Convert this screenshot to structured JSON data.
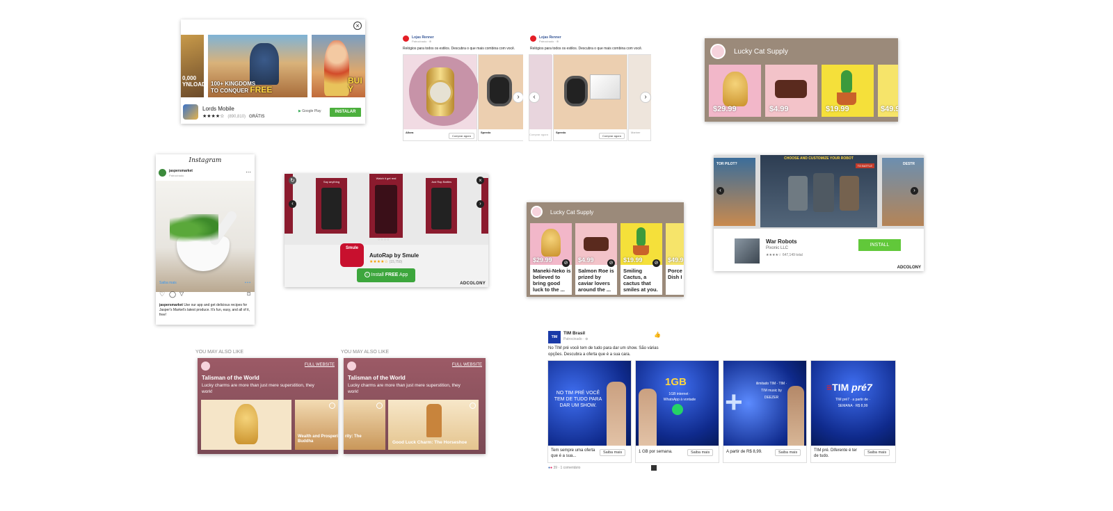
{
  "lords": {
    "close": "×",
    "app_name": "Lords Mobile",
    "stars": "★★★★☆",
    "reviews": "(890,810)",
    "price": "GRÁTIS",
    "store": "Google Play",
    "install": "INSTALAR",
    "banner1": "100+ KINGDOMS",
    "banner2": "TO CONQUER",
    "banner_free": "FREE",
    "left_text": "0,000",
    "left_text2": "YNLOADS",
    "right_text": "BUI",
    "right_text2": "Y"
  },
  "renner": {
    "brand": "Lojas Renner",
    "sponsored": "Patrocinado · ⊕",
    "copy": "Relógios para todos os estilos. Descubra o que mais combina com você.",
    "cta": "Comprar agora",
    "a": {
      "item1": "Allora",
      "item2": "Speedo"
    },
    "b": {
      "item1": "Speedo",
      "item2": "Mariner"
    }
  },
  "lucky_top": {
    "title": "Lucky Cat Supply",
    "prices": [
      "$29.99",
      "$4.99",
      "$19.99",
      "$49.9"
    ]
  },
  "instagram": {
    "logo": "Instagram",
    "handle": "jaspersmarket",
    "sponsored": "Patrocinado",
    "learn": "Saiba mais",
    "caption_user": "jaspersmarket",
    "caption": "Use our app and get delicious recipes for Jasper's Market's latest produce. It's fun, easy, and all of it, free!"
  },
  "autorap": {
    "app_name": "AutoRap by Smule",
    "stars": "★★★★☆",
    "reviews": "(15,750)",
    "install_pre": "Install ",
    "install_bold": "FREE",
    "install_post": " App",
    "brand": "ADCOLONY",
    "logo": "Smule",
    "screens": [
      "Say anything",
      "Watch it get real",
      "Just Rap Battles"
    ]
  },
  "lucky_mid": {
    "title": "Lucky Cat Supply",
    "prices": [
      "$29.99",
      "$4.99",
      "$19.99",
      "$49.9"
    ],
    "descs": [
      "Maneki-Neko is believed to bring good luck to the ...",
      "Salmon Roe is prized by caviar lovers around the ...",
      "Smiling Cactus, a cactus that smiles at you.",
      "Porce Dish I"
    ]
  },
  "warrobots": {
    "app_name": "War Robots",
    "developer": "Pixonic LLC",
    "stars": "★★★★☆",
    "reviews": "647,149 total",
    "install": "INSTALL",
    "brand": "ADCOLONY",
    "screen_title": "CHOOSE AND CUSTOMIZE YOUR ROBOT",
    "battle": "TO BATTLE",
    "left_label": "TOR PILOT?",
    "right_label": "DESTR"
  },
  "talisman": {
    "section": "YOU MAY ALSO LIKE",
    "full_site": "FULL WEBSITE",
    "title": "Talisman of the World",
    "body": "Lucky charms are more than just mere superstition, they work!",
    "a": {
      "cap1": "",
      "cap2": "Wealth and Prosperity: The Laughing Buddha"
    },
    "b": {
      "cap1": "rity: The",
      "cap2": "Good Luck Charm: The Horseshoe"
    }
  },
  "tim": {
    "brand": "TIM Brasil",
    "sponsored": "Patrocinado · ⊕",
    "copy": "No TIM pré você tem de tudo para dar um show. São várias opções. Descubra a oferta que é a sua cara.",
    "cta": "Saiba mais",
    "cards": [
      {
        "img": "NO TIM PRÉ VOCÊ TEM DE TUDO PARA DAR UM SHOW.",
        "desc": "Tem sempre uma oferta que é a sua..."
      },
      {
        "img": "1GB internet · WhatsApp à vontade",
        "desc": "1 GB por semana."
      },
      {
        "img": "ilimitado TIM - TIM · TIM music by DEEZER",
        "desc": "A partir de R$ 8,99."
      },
      {
        "img": "TIM pré7 · a partir de · SEMANA · R$ 8,99",
        "desc": "TIM pré. Diferente é ter de tudo."
      }
    ],
    "reactions": "39 · 1 comentário"
  },
  "colors": {
    "lucky_header": "#9b8a7a",
    "renner_red": "#e41e26",
    "green": "#4caf3d",
    "tim_blue": "#1a3aa8",
    "smule_red": "#8b1b2e"
  }
}
